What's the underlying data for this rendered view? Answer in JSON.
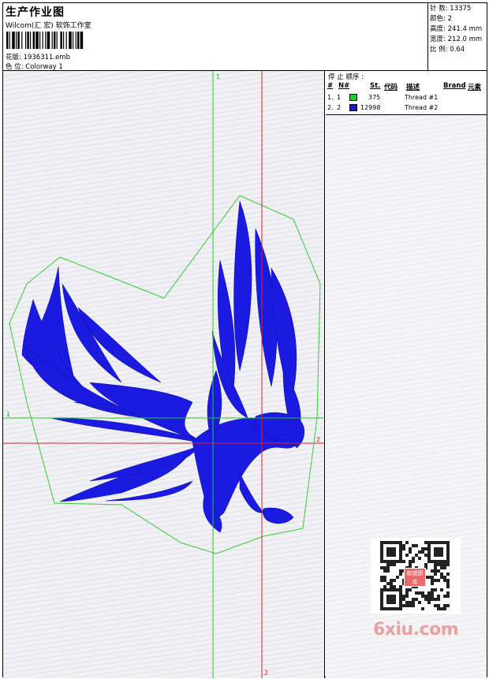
{
  "header": {
    "title": "生产作业图",
    "subtitle": "Wilcom(汇 宏) 软饰工作室",
    "file_label": "花版:",
    "file_name": "1936311.emb",
    "colorway_label": "色 位:",
    "colorway_name": "Colorway 1"
  },
  "stats": [
    {
      "label": "针 数:",
      "value": "13375"
    },
    {
      "label": "颜色:",
      "value": "2"
    },
    {
      "label": "高度:",
      "value": "241.4 mm"
    },
    {
      "label": "宽度:",
      "value": "212.0 mm"
    },
    {
      "label": "比 例:",
      "value": "0.64"
    }
  ],
  "stop_sequence": {
    "title": "停 止 顺序 :",
    "columns": {
      "index": "#",
      "needle": "N#",
      "stitches": "St.",
      "code": "代码",
      "description": "描述",
      "brand": "Brand",
      "element": "元素"
    },
    "rows": [
      {
        "index": "1.",
        "needle": "1",
        "color": "#22cc22",
        "code": "375",
        "description": "Thread #1"
      },
      {
        "index": "2.",
        "needle": "2",
        "color": "#1a1acc",
        "code": "12998",
        "description": "Thread #2"
      }
    ]
  },
  "guides": {
    "green_top": "1",
    "green_left": "1",
    "red_right": "2",
    "red_bottom": "2",
    "green_color": "#22cc22",
    "red_color": "#dd2222"
  },
  "design": {
    "fill_color": "#1a1ae0",
    "outline_color": "#33cc33",
    "subject": "eagle"
  },
  "watermark": {
    "brand": "6xiu.com",
    "qr_badge": "权威图库"
  }
}
